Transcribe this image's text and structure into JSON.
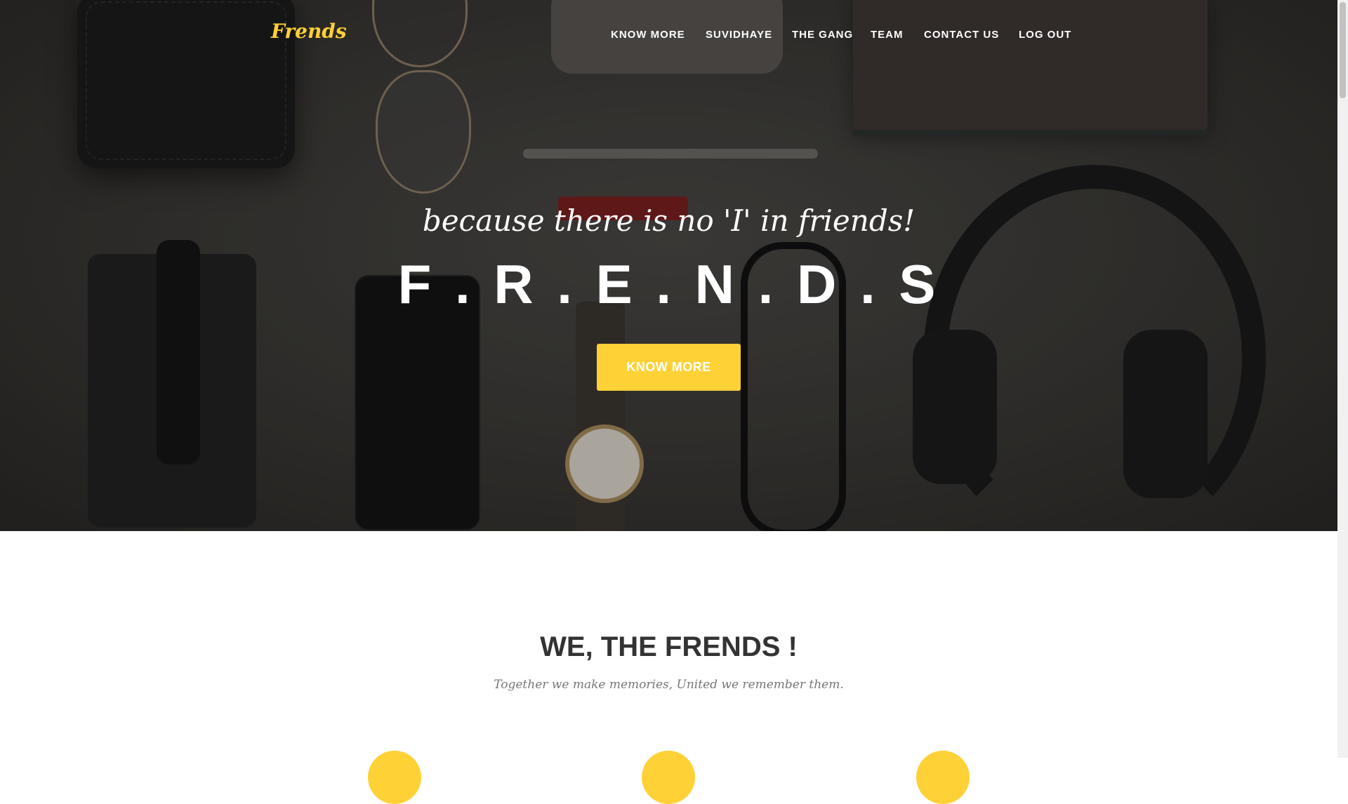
{
  "brand": {
    "logo": "Frends",
    "accent": "#fed136"
  },
  "nav": {
    "items": [
      {
        "label": "KNOW MORE"
      },
      {
        "label": "SUVIDHAYE"
      },
      {
        "label": "THE GANG"
      },
      {
        "label": "TEAM"
      },
      {
        "label": "CONTACT US"
      },
      {
        "label": "LOG OUT"
      }
    ]
  },
  "hero": {
    "tagline": "because there is no 'I' in friends!",
    "title": "F . R . E . N . D . S",
    "button_label": "KNOW MORE"
  },
  "about": {
    "heading": "WE, THE FRENDS !",
    "subheading": "Together we make memories, United we remember them."
  }
}
